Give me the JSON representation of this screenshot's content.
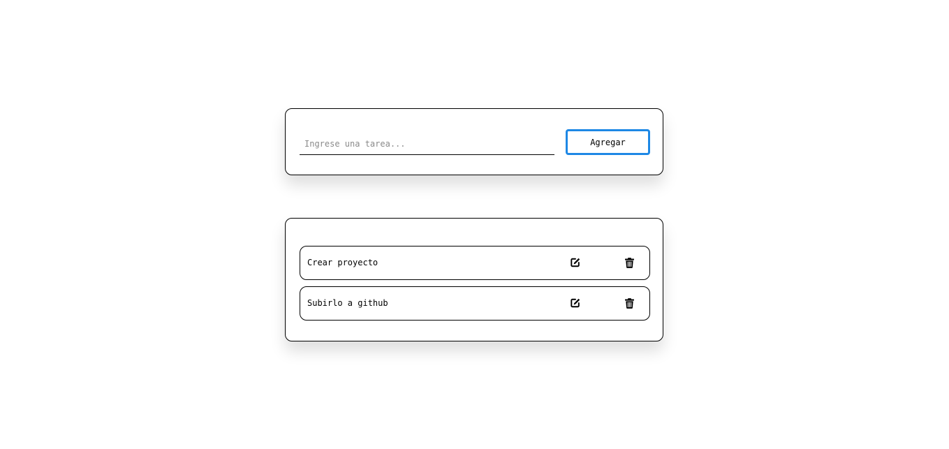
{
  "form": {
    "input_value": "",
    "input_placeholder": "Ingrese una tarea...",
    "add_button_label": "Agregar"
  },
  "tasks": [
    {
      "label": "Crear proyecto",
      "edit_icon": "edit-icon",
      "delete_icon": "trash-icon"
    },
    {
      "label": "Subirlo a github",
      "edit_icon": "edit-icon",
      "delete_icon": "trash-icon"
    }
  ],
  "colors": {
    "accent": "#1e88e5",
    "border": "#000000",
    "background": "#ffffff"
  }
}
